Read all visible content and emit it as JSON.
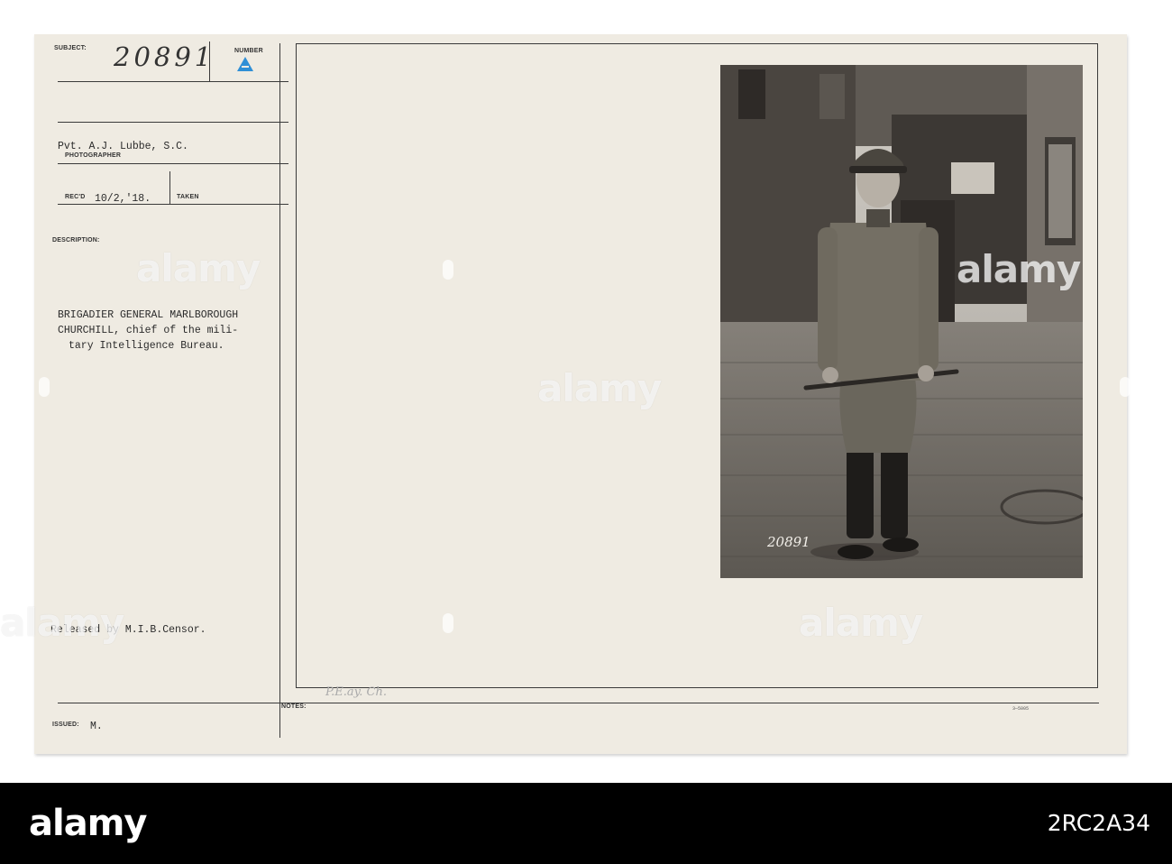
{
  "card": {
    "labels": {
      "subject": "SUBJECT:",
      "number": "NUMBER",
      "photographer": "PHOTOGRAPHER",
      "recd": "REC'D",
      "taken": "TAKEN",
      "description": "DESCRIPTION:",
      "issued": "ISSUED:",
      "notes": "NOTES:"
    },
    "subject_number": "20891",
    "number_letter": "A",
    "photographer_name": "Pvt. A.J. Lubbe, S.C.",
    "received_date": "10/2,'18.",
    "description_lines": [
      "BRIGADIER GENERAL MARLBOROUGH",
      "CHURCHILL, chief of the mili-",
      "tary Intelligence Bureau."
    ],
    "release_note": "Released by M.I.B.Censor.",
    "issued_value": "M.",
    "pencil_note": "P.E.ay. Ch.",
    "stock_number": "3—5005"
  },
  "photo": {
    "negative_number": "20891"
  },
  "watermarks": {
    "brand": "alamy"
  },
  "footer": {
    "brand": "alamy",
    "image_ref": "2RC2A34"
  }
}
